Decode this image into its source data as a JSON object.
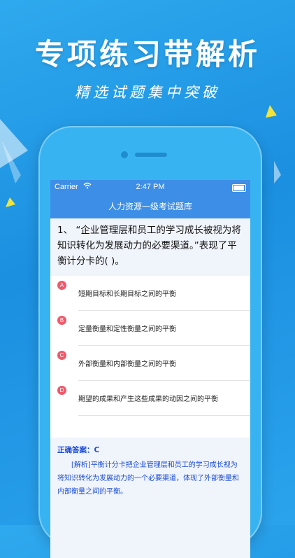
{
  "banner": {
    "headline": "专项练习带解析",
    "subline": "精选试题集中突破"
  },
  "status_bar": {
    "carrier": "Carrier",
    "time": "2:47 PM"
  },
  "nav": {
    "title": "人力资源一级考试题库"
  },
  "question": {
    "text": "1、 “企业管理层和员工的学习成长被视为将知识转化为发展动力的必要渠道。”表现了平衡计分卡的(    )。"
  },
  "options": [
    {
      "letter": "A",
      "text": "短期目标和长期目标之间的平衡"
    },
    {
      "letter": "B",
      "text": "定量衡量和定性衡量之间的平衡"
    },
    {
      "letter": "C",
      "text": "外部衡量和内部衡量之间的平衡"
    },
    {
      "letter": "D",
      "text": "期望的成果和产生这些成果的动因之间的平衡"
    }
  ],
  "answer": {
    "label": "正确答案：C",
    "analysis": "[解析]平衡计分卡把企业管理层和员工的学习成长视为将知识转化为发展动力的一个必要渠道，体现了外部衡量和内部衡量之间的平衡。"
  },
  "colors": {
    "background": "#1b8fe0",
    "nav_bar": "#3d8ee6",
    "option_badge": "#ef5a6b",
    "answer_text": "#1a4bd6"
  }
}
